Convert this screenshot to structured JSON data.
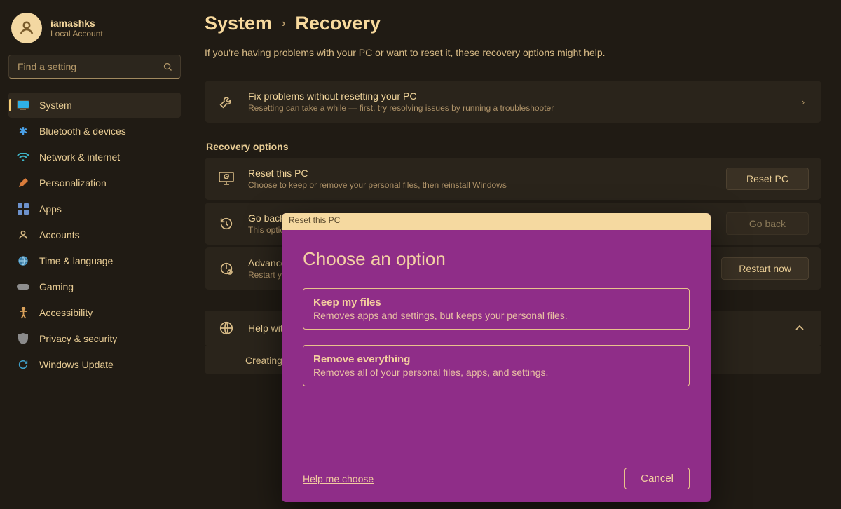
{
  "profile": {
    "name": "iamashks",
    "subtitle": "Local Account"
  },
  "search": {
    "placeholder": "Find a setting"
  },
  "nav": {
    "items": [
      {
        "label": "System",
        "icon": "system",
        "active": true
      },
      {
        "label": "Bluetooth & devices",
        "icon": "bluetooth",
        "active": false
      },
      {
        "label": "Network & internet",
        "icon": "network",
        "active": false
      },
      {
        "label": "Personalization",
        "icon": "personal",
        "active": false
      },
      {
        "label": "Apps",
        "icon": "apps",
        "active": false
      },
      {
        "label": "Accounts",
        "icon": "accounts",
        "active": false
      },
      {
        "label": "Time & language",
        "icon": "time",
        "active": false
      },
      {
        "label": "Gaming",
        "icon": "gaming",
        "active": false
      },
      {
        "label": "Accessibility",
        "icon": "access",
        "active": false
      },
      {
        "label": "Privacy & security",
        "icon": "privacy",
        "active": false
      },
      {
        "label": "Windows Update",
        "icon": "update",
        "active": false
      }
    ]
  },
  "breadcrumb": {
    "parent": "System",
    "current": "Recovery"
  },
  "subtitle": "If you're having problems with your PC or want to reset it, these recovery options might help.",
  "fixproblems": {
    "title": "Fix problems without resetting your PC",
    "sub": "Resetting can take a while — first, try resolving issues by running a troubleshooter"
  },
  "recovery_section": "Recovery options",
  "reset": {
    "title": "Reset this PC",
    "sub": "Choose to keep or remove your personal files, then reinstall Windows",
    "button": "Reset PC"
  },
  "goback": {
    "title": "Go back",
    "sub": "This option",
    "button": "Go back"
  },
  "advanced": {
    "title": "Advanced",
    "sub": "Restart you",
    "button": "Restart now"
  },
  "help": {
    "title": "Help with",
    "subrow": "Creating a"
  },
  "modal": {
    "titlebar": "Reset this PC",
    "heading": "Choose an option",
    "opt1_title": "Keep my files",
    "opt1_sub": "Removes apps and settings, but keeps your personal files.",
    "opt2_title": "Remove everything",
    "opt2_sub": "Removes all of your personal files, apps, and settings.",
    "help": "Help me choose",
    "cancel": "Cancel"
  }
}
